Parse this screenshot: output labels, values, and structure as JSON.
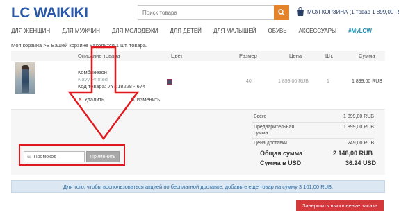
{
  "logo": "LC WAIKIKI",
  "search": {
    "placeholder": "Поиск товара"
  },
  "cart": {
    "label": "МОЯ КОРЗИНА (1 товар 1 899,00 RUB)"
  },
  "nav": [
    "ДЛЯ ЖЕНЩИН",
    "ДЛЯ МУЖЧИН",
    "ДЛЯ МОЛОДЕЖИ",
    "ДЛЯ ДЕТЕЙ",
    "ДЛЯ МАЛЫШЕЙ",
    "ОБУВЬ",
    "АКСЕССУАРЫ",
    "#MyLCW"
  ],
  "breadcrumb": "Моя корзина >В Вашей корзине находится 1 шт. товара.",
  "table": {
    "headers": [
      "Описание товара",
      "Цвет",
      "Размер",
      "Цена",
      "Шт.",
      "Сумма"
    ],
    "row": {
      "name": "Комбинезон",
      "color_name": "Navy Printed",
      "code": "Код товара: 7YK18228 - 674",
      "size": "40",
      "price": "1 899,00 RUB",
      "qty": "1",
      "sum": "1 899,00 RUB",
      "delete": "Удалить",
      "edit": "Изменить"
    }
  },
  "summary": {
    "total_label": "Всего",
    "total_value": "1 899,00 RUB",
    "pre_label_1": "Предварительная",
    "pre_label_2": "сумма",
    "pre_value": "1 899,00 RUB",
    "delivery_label": "Цена доставки",
    "delivery_value": "249,00 RUB",
    "grand_label": "Общая сумма",
    "grand_value": "2 148,00 RUB",
    "usd_label": "Сумма в USD",
    "usd_value": "36.24 USD"
  },
  "promo": {
    "placeholder": "Промокод",
    "apply": "Применить"
  },
  "notice": "Для того, чтобы воспользоваться акцией по бесплатной доставке, добавьте еще товар на сумму 3 101,00 RUB.",
  "checkout": "Завершить выполнение заказа",
  "colors": {
    "brand": "#2b59a7",
    "accent": "#e4832a",
    "checkout": "#d3383a",
    "highlight": "#e0191f"
  },
  "icons": {
    "search": "search-icon",
    "cart": "shopping-bag-icon",
    "delete": "close-icon",
    "edit": "pencil-icon",
    "promo": "ticket-icon"
  }
}
